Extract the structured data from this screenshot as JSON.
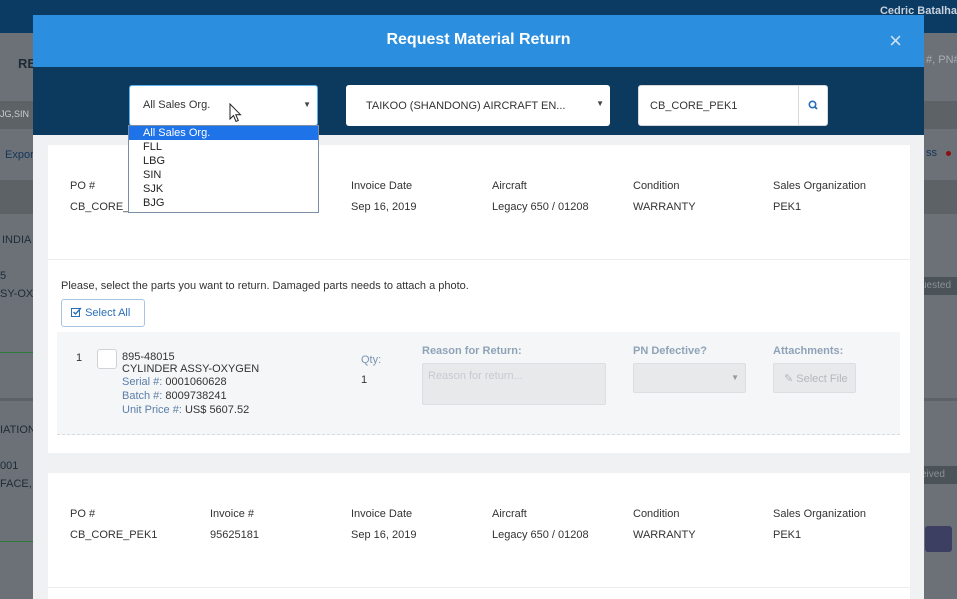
{
  "background": {
    "user_name": "Cedric Batalha",
    "fragments": [
      "RE",
      "JG,SIN",
      "Expor",
      "INDIA",
      "5",
      "SY-OX",
      "IATION",
      "001",
      "FACE,",
      "#, PN#",
      "ss",
      "uested",
      "eived"
    ]
  },
  "modal": {
    "title": "Request Material Return",
    "close_icon": "close-icon"
  },
  "filters": {
    "sales_org": {
      "value": "All Sales Org.",
      "options": [
        "All Sales Org.",
        "FLL",
        "LBG",
        "SIN",
        "SJK",
        "BJG"
      ],
      "highlighted": "All Sales Org."
    },
    "customer": {
      "value": "TAIKOO (SHANDONG) AIRCRAFT EN..."
    },
    "search": {
      "value": "CB_CORE_PEK1",
      "icon": "search-icon"
    }
  },
  "invoices": [
    {
      "fields": [
        {
          "label": "PO #",
          "value": "CB_CORE_"
        },
        {
          "label": "Invoice Date",
          "value": "Sep 16, 2019"
        },
        {
          "label": "Aircraft",
          "value": "Legacy 650 / 01208"
        },
        {
          "label": "Condition",
          "value": "WARRANTY"
        },
        {
          "label": "Sales Organization",
          "value": "PEK1"
        }
      ],
      "instructions": "Please, select the parts you want to return. Damaged parts needs to attach a photo.",
      "select_all_label": "Select All",
      "parts": [
        {
          "index": "1",
          "pn": "895-48015",
          "description": "CYLINDER ASSY-OXYGEN",
          "serial_label": "Serial #:",
          "serial": "0001060628",
          "batch_label": "Batch #:",
          "batch": "8009738241",
          "price_label": "Unit Price #:",
          "price": "US$ 5607.52",
          "qty_label": "Qty:",
          "qty": "1",
          "reason_label": "Reason for Return:",
          "reason_placeholder": "Reason for return...",
          "pn_defective_label": "PN Defective?",
          "attachments_label": "Attachments:",
          "select_file_label": "Select File"
        }
      ]
    },
    {
      "fields": [
        {
          "label": "PO #",
          "value": "CB_CORE_PEK1"
        },
        {
          "label": "Invoice #",
          "value": "95625181"
        },
        {
          "label": "Invoice Date",
          "value": "Sep 16, 2019"
        },
        {
          "label": "Aircraft",
          "value": "Legacy 650 / 01208"
        },
        {
          "label": "Condition",
          "value": "WARRANTY"
        },
        {
          "label": "Sales Organization",
          "value": "PEK1"
        }
      ]
    }
  ],
  "colors": {
    "header": "#2b8ede",
    "toolbar": "#0c3a5e",
    "dropdown_highlight": "#1e73e8"
  }
}
